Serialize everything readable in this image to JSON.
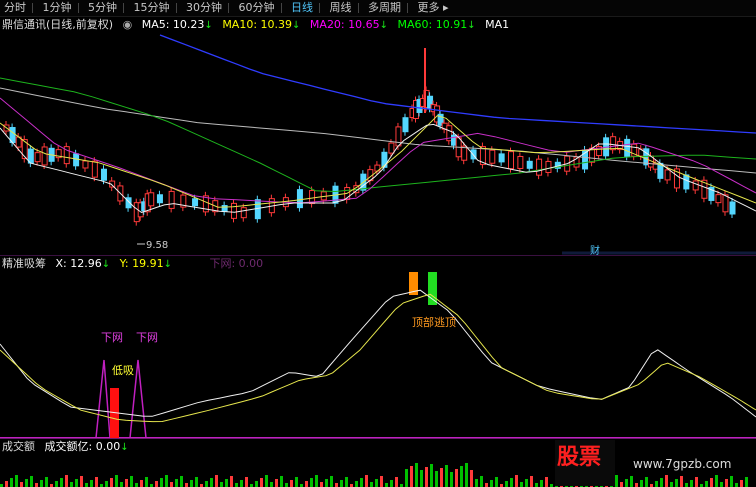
{
  "period_tabs": [
    {
      "label": "分时",
      "active": false
    },
    {
      "label": "1分钟",
      "active": false
    },
    {
      "label": "5分钟",
      "active": false
    },
    {
      "label": "15分钟",
      "active": false
    },
    {
      "label": "30分钟",
      "active": false
    },
    {
      "label": "60分钟",
      "active": false
    },
    {
      "label": "日线",
      "active": true
    },
    {
      "label": "周线",
      "active": false
    },
    {
      "label": "多周期",
      "active": false
    },
    {
      "label": "更多",
      "active": false
    }
  ],
  "main_chart": {
    "stock_title": "鼎信通讯(日线,前复权)",
    "ma_labels": [
      {
        "text": "MA5: 10.23",
        "arrow": "↓",
        "color": "#ffffff"
      },
      {
        "text": "MA10: 10.39",
        "arrow": "↓",
        "color": "#ffff00"
      },
      {
        "text": "MA20: 10.65",
        "arrow": "↓",
        "color": "#ff00ff"
      },
      {
        "text": "MA60: 10.91",
        "arrow": "↓",
        "color": "#00ff00"
      },
      {
        "text": "MA1",
        "arrow": "",
        "color": "#ffffff"
      }
    ],
    "low_marker": "9.58",
    "fin_marker": "财"
  },
  "indicator_panel": {
    "name": "精准吸筹",
    "x_label": "X: 12.96",
    "x_arrow": "↓",
    "y_label": "Y: 19.91",
    "y_arrow": "↓",
    "faint_label": "下网: 0.00",
    "annotations": {
      "down_net_1": "下网",
      "down_net_2": "下网",
      "low_buy": "低吸",
      "top_escape": "顶部逃顶"
    }
  },
  "volume_panel": {
    "name": "成交额",
    "amount_label": "成交额亿: 0.00",
    "amount_arrow": "↓"
  },
  "watermark": {
    "brand": "股票",
    "url": "www.7gpzb.com"
  }
}
